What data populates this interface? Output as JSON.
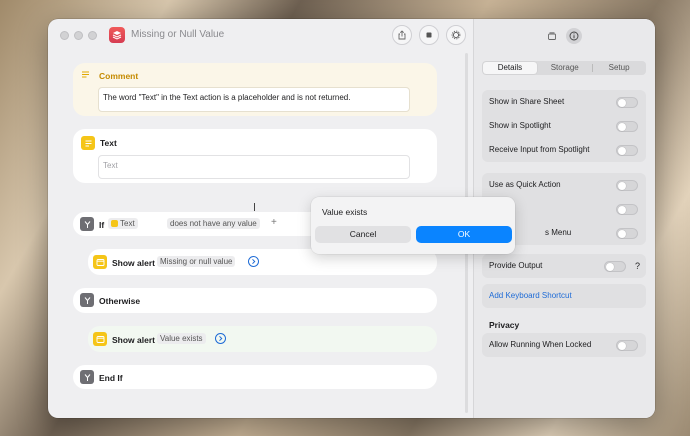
{
  "window": {
    "title": "Missing or Null Value"
  },
  "actions": {
    "comment": {
      "label": "Comment",
      "text": "The word \"Text\" in the Text action is a placeholder and is not returned."
    },
    "text": {
      "label": "Text",
      "placeholder": "Text"
    },
    "if": {
      "label": "If",
      "var": "Text",
      "condition": "does not have any value",
      "add": "+"
    },
    "show_alert_1": {
      "label": "Show alert",
      "value": "Missing or null value"
    },
    "otherwise": {
      "label": "Otherwise"
    },
    "show_alert_2": {
      "label": "Show alert",
      "value": "Value exists"
    },
    "end_if": {
      "label": "End If"
    }
  },
  "sidebar": {
    "tabs": [
      "Details",
      "Storage",
      "Setup"
    ],
    "active_tab": "Details",
    "options": [
      {
        "label": "Show in Share Sheet"
      },
      {
        "label": "Show in Spotlight"
      },
      {
        "label": "Receive Input from Spotlight"
      },
      {
        "label": "Use as Quick Action"
      },
      {
        "label": ""
      },
      {
        "label": "s Menu"
      }
    ],
    "provide_output": "Provide Output",
    "provide_output_help": "?",
    "keyboard_shortcut": "Add Keyboard Shortcut",
    "privacy_heading": "Privacy",
    "allow_locked": "Allow Running When Locked"
  },
  "alert": {
    "message": "Value exists",
    "cancel": "Cancel",
    "ok": "OK"
  },
  "colors": {
    "accent": "#0a84ff",
    "link": "#1e6bd6",
    "yellow": "#f5c518"
  }
}
